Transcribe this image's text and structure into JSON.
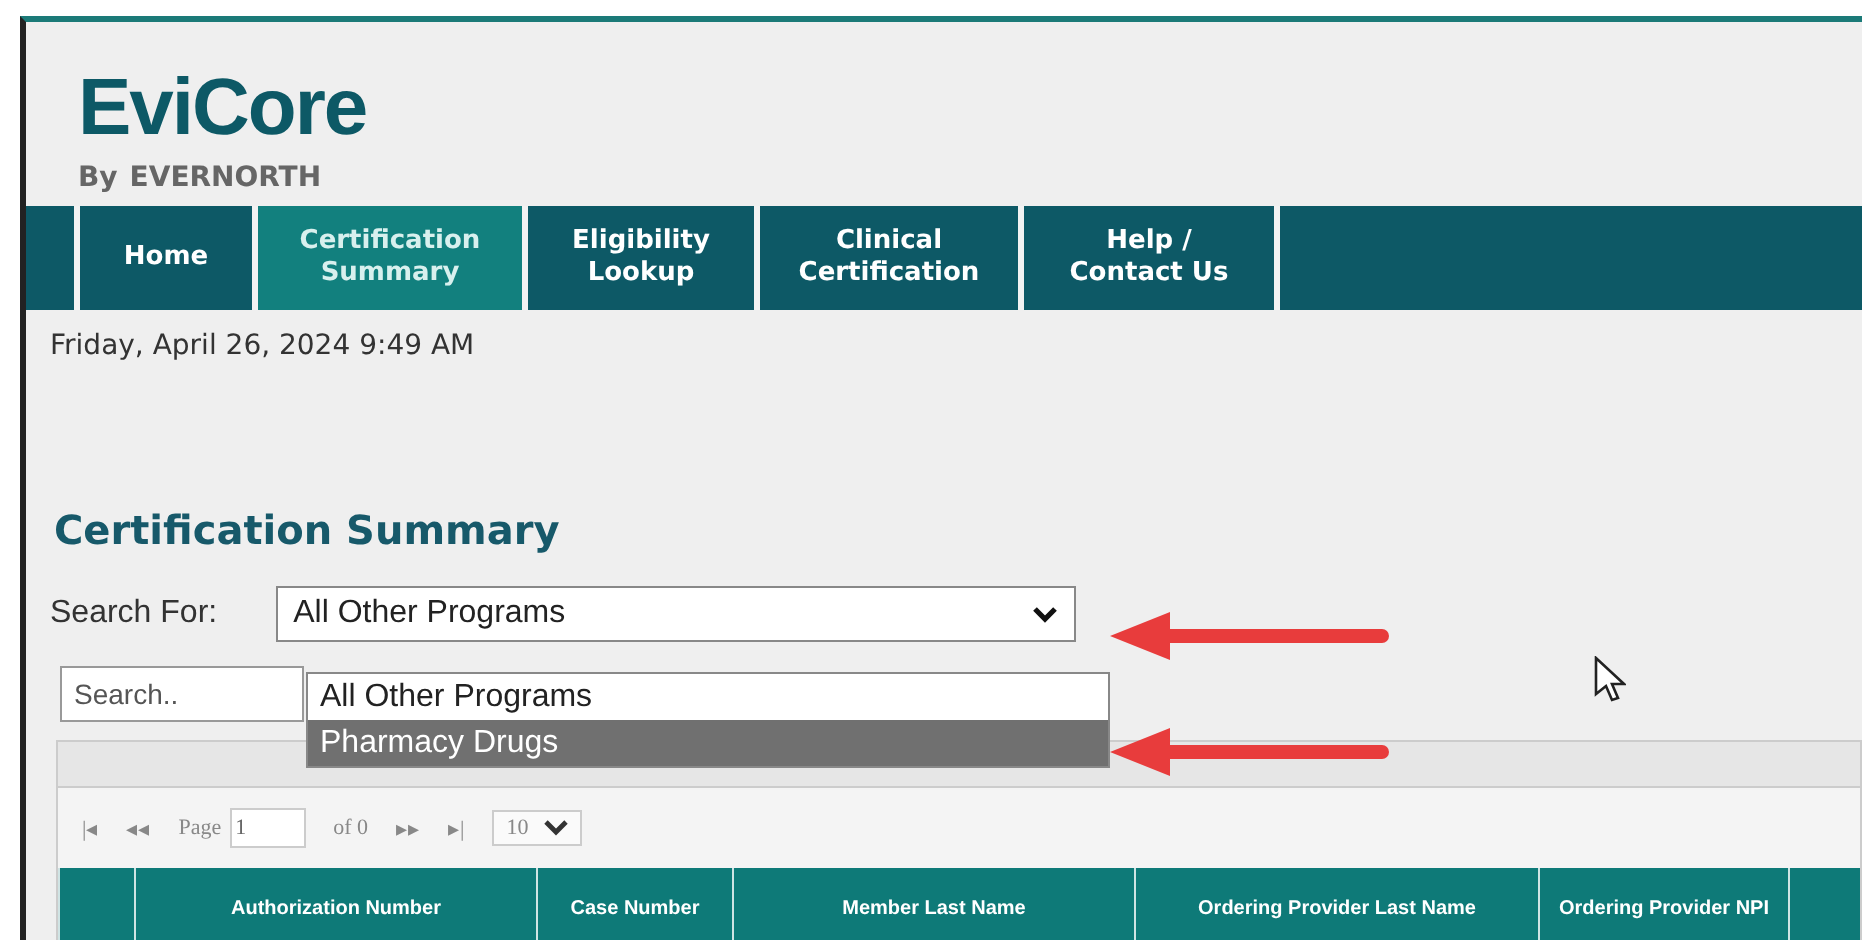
{
  "logo": {
    "name": "EviCore",
    "byline": "By",
    "brand": "EVERNORTH"
  },
  "nav": [
    {
      "label": "Home",
      "selected": false
    },
    {
      "label": "Certification Summary",
      "selected": true
    },
    {
      "label": "Eligibility Lookup",
      "selected": false
    },
    {
      "label": "Clinical Certification",
      "selected": false
    },
    {
      "label": "Help / Contact Us",
      "selected": false
    }
  ],
  "date": "Friday, April 26, 2024 9:49 AM",
  "heading": "Certification Summary",
  "search_for": {
    "label": "Search For:",
    "value": "All Other Programs",
    "options": [
      {
        "label": "All Other Programs",
        "highlighted": false
      },
      {
        "label": "Pharmacy Drugs",
        "highlighted": true
      }
    ]
  },
  "search": {
    "placeholder": "Search.."
  },
  "pager": {
    "first": "|◂",
    "prev": "◂◂",
    "page_label": "Page",
    "page": "1",
    "of": "of 0",
    "next": "▸▸",
    "last": "▸|",
    "page_size": "10"
  },
  "table": {
    "columns": [
      "Authorization Number",
      "Case Number",
      "Member Last Name",
      "Ordering Provider Last Name",
      "Ordering Provider NPI"
    ]
  }
}
